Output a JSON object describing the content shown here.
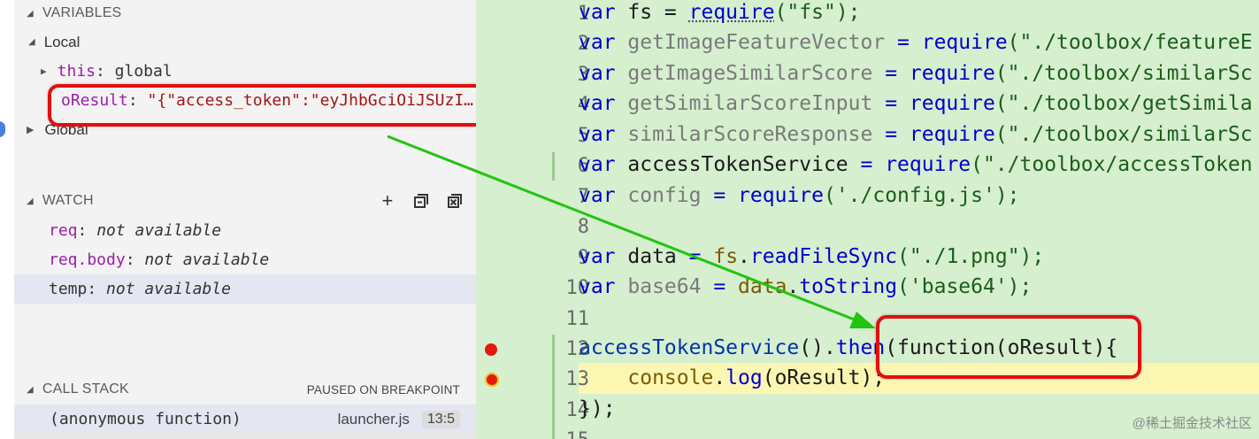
{
  "variables": {
    "header": "VARIABLES",
    "local_label": "Local",
    "global_label": "Global",
    "this_key": "this",
    "this_value": "global",
    "oresult_key": "oResult",
    "oresult_value": "\"{\"access_token\":\"eyJhbGciOiJSUzI…"
  },
  "watch": {
    "header": "WATCH",
    "items": [
      {
        "key": "req",
        "value": "not available"
      },
      {
        "key": "req.body",
        "value": "not available"
      },
      {
        "key": "temp",
        "value": "not available"
      }
    ]
  },
  "call_stack": {
    "header": "CALL STACK",
    "status": "PAUSED ON BREAKPOINT",
    "frame_name": "(anonymous function)",
    "frame_file": "launcher.js",
    "frame_pos": "13:5"
  },
  "editor": {
    "line_numbers": [
      "1",
      "2",
      "3",
      "4",
      "5",
      "6",
      "7",
      "8",
      "9",
      "10",
      "11",
      "12",
      "13",
      "14",
      "15"
    ],
    "l1": {
      "kw": "var",
      "name": " fs = ",
      "fn": "require",
      "arg": "(\"fs\");"
    },
    "l2": {
      "kw": "var",
      "name": " getImageFeatureVector",
      "eq": " = ",
      "fn": "require",
      "arg": "(\"./toolbox/featureE"
    },
    "l3": {
      "kw": "var",
      "name": " getImageSimilarScore",
      "eq": " = ",
      "fn": "require",
      "arg": "(\"./toolbox/similarSc"
    },
    "l4": {
      "kw": "var",
      "name": " getSimilarScoreInput",
      "eq": " = ",
      "fn": "require",
      "arg": "(\"./toolbox/getSimila"
    },
    "l5": {
      "kw": "var",
      "name": " similarScoreResponse",
      "eq": " = ",
      "fn": "require",
      "arg": "(\"./toolbox/similarSc"
    },
    "l6": {
      "kw": "var",
      "name": " accessTokenService",
      "eq": " = ",
      "fn": "require",
      "arg": "(\"./toolbox/accessToken"
    },
    "l7": {
      "kw": "var",
      "name": " config",
      "eq": " = ",
      "fn": "require",
      "arg": "('./config.js');"
    },
    "l9": {
      "kw": "var",
      "name": " data",
      "eq": " = ",
      "obj": "fs",
      "dot": ".",
      "fn": "readFileSync",
      "arg": "(\"./1.png\");"
    },
    "l10": {
      "kw": "var",
      "name": " base64",
      "eq": " = ",
      "obj": "data",
      "dot": ".",
      "fn": "toString",
      "arg": "('base64');"
    },
    "l12": {
      "fn": "accessTokenService",
      "mid": "().",
      "then": "then",
      "rest": "(function(oResult){"
    },
    "l13": {
      "indent": "    ",
      "obj": "console",
      "dot": ".",
      "fn": "log",
      "arg": "(oResult);"
    },
    "l14": {
      "text": "});"
    }
  },
  "watermark": "@稀土掘金技术社区",
  "colors": {
    "accent_red": "#e20f0f",
    "arrow_green": "#22c411",
    "editor_bg": "#d6efcf",
    "current_line": "#fbf7b3"
  }
}
